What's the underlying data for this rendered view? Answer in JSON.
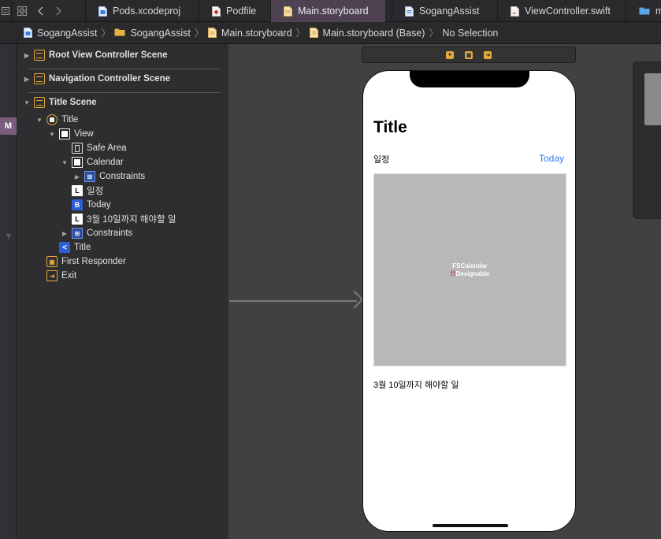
{
  "tabs": [
    {
      "label": "Pods.xcodeproj",
      "icon": "xcodeproj-file-icon"
    },
    {
      "label": "Podfile",
      "icon": "ruby-file-icon"
    },
    {
      "label": "Main.storyboard",
      "icon": "storyboard-file-icon",
      "active": true
    },
    {
      "label": "SogangAssist",
      "icon": "plist-file-icon"
    },
    {
      "label": "ViewController.swift",
      "icon": "swift-file-icon"
    },
    {
      "label": "m",
      "icon": "folder-icon"
    }
  ],
  "jumpbar": {
    "project": "SogangAssist",
    "group": "SogangAssist",
    "file": "Main.storyboard",
    "variant": "Main.storyboard (Base)",
    "selection": "No Selection"
  },
  "leftstrip": {
    "m_badge": "M",
    "q_badge": "?"
  },
  "outline": {
    "scene_root": "Root View Controller Scene",
    "scene_nav": "Navigation Controller Scene",
    "scene_title": "Title Scene",
    "vc_title": "Title",
    "view": "View",
    "safe_area": "Safe Area",
    "calendar": "Calendar",
    "constraints_inner": "Constraints",
    "label_schedule": "일정",
    "button_today": "Today",
    "label_task": "3월 10일까지 해야할 일",
    "constraints": "Constraints",
    "nav_item_title": "Title",
    "first_responder": "First Responder",
    "exit": "Exit",
    "icon_letters": {
      "label": "L",
      "button": "B",
      "nav": "<"
    }
  },
  "phone": {
    "title": "Title",
    "schedule_label": "일정",
    "today_button": "Today",
    "calendar_name": "FSCalendar",
    "calendar_status": "Designable",
    "calendar_warn": "!!",
    "task_label": "3월 10일까지 해야할 일"
  },
  "colors": {
    "accent_tab": "#4e4152",
    "today_blue": "#2f7cf6",
    "scene_icon": "#e4a93a",
    "calendar_bg": "#b8b8b8"
  }
}
